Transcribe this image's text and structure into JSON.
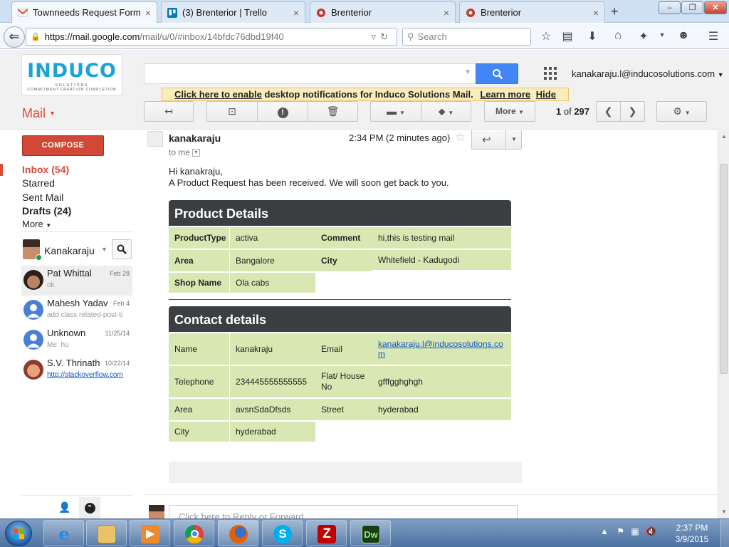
{
  "browser": {
    "tabs": [
      {
        "title": "Townneeds Request Form ...",
        "close": "×"
      },
      {
        "title": "(3) Brenterior | Trello",
        "close": "×"
      },
      {
        "title": "Brenterior",
        "close": "×"
      },
      {
        "title": "Brenterior",
        "close": "×"
      }
    ],
    "new_tab": "+",
    "url_host": "https://mail.google.com",
    "url_path": "/mail/u/0/#inbox/14bfdc76dbd19f40",
    "search_placeholder": "Search"
  },
  "gmail": {
    "logo_main": "INDUCO",
    "logo_sub": "SOLUTIONS",
    "logo_tag": "COMMITMENT.CREATION.COMPLETION",
    "account": "kanakaraju.l@inducosolutions.com",
    "notification": {
      "link1": "Click here to enable",
      "text": "desktop notifications for Induco Solutions Mail.",
      "link2": "Learn more",
      "link3": "Hide"
    },
    "mail_label": "Mail",
    "more_button": "More",
    "pager_current": "1",
    "pager_of": "of",
    "pager_total": "297",
    "compose": "COMPOSE",
    "nav": [
      {
        "label": "Inbox (54)"
      },
      {
        "label": "Starred"
      },
      {
        "label": "Sent Mail"
      },
      {
        "label": "Drafts (24)"
      },
      {
        "label": "More"
      }
    ],
    "hangouts_user": "Kanakaraju",
    "contacts": [
      {
        "name": "Pat Whittal",
        "date": "Feb 28",
        "sub": "ok"
      },
      {
        "name": "Mahesh Yadav",
        "date": "Feb 4",
        "sub": "add class related-post-ti"
      },
      {
        "name": "Unknown",
        "date": "11/25/14",
        "sub": "Me: hu"
      },
      {
        "name": "S.V. Thrinath",
        "date": "10/22/14",
        "sub": "http://stackoverflow.com"
      }
    ]
  },
  "message": {
    "sender": "kanakaraju",
    "to": "to me",
    "time": "2:34 PM (2 minutes ago)",
    "greeting": "Hi kanakraju,",
    "body": "A Product Request has been received. We will soon get back to you.",
    "product_title": "Product Details",
    "product": {
      "type_label": "ProductType",
      "type_value": "activa",
      "comment_label": "Comment",
      "comment_value": "hi,this is testing mail",
      "area_label": "Area",
      "area_value": "Bangalore",
      "city_label": "City",
      "city_value": "Whitefield - Kadugodi",
      "shop_label": "Shop Name",
      "shop_value": "Ola cabs"
    },
    "contact_title": "Contact details",
    "contact": {
      "name_label": "Name",
      "name_value": "kanakraju",
      "email_label": "Email",
      "email_value": "kanakaraju.l@inducosolutions.com",
      "tel_label": "Telephone",
      "tel_value": "234445555555555",
      "flat_label": "Flat/ House No",
      "flat_value": "gfffgghghgh",
      "area_label": "Area",
      "area_value": "avsnSdaDfsds",
      "street_label": "Street",
      "street_value": "hyderabad",
      "city_label": "City",
      "city_value": "hyderabad"
    },
    "reply_placeholder": "Click here to Reply or Forward"
  },
  "taskbar": {
    "time": "2:37 PM",
    "date": "3/9/2015",
    "apps": [
      "internet-explorer",
      "file-explorer",
      "media-player",
      "chrome",
      "firefox",
      "skype",
      "filezilla",
      "dreamweaver"
    ]
  },
  "colors": {
    "gmail_red": "#dd4b39",
    "search_blue": "#4285f4",
    "table_green": "#d9e8b3",
    "header_dark": "#3c3f41"
  }
}
